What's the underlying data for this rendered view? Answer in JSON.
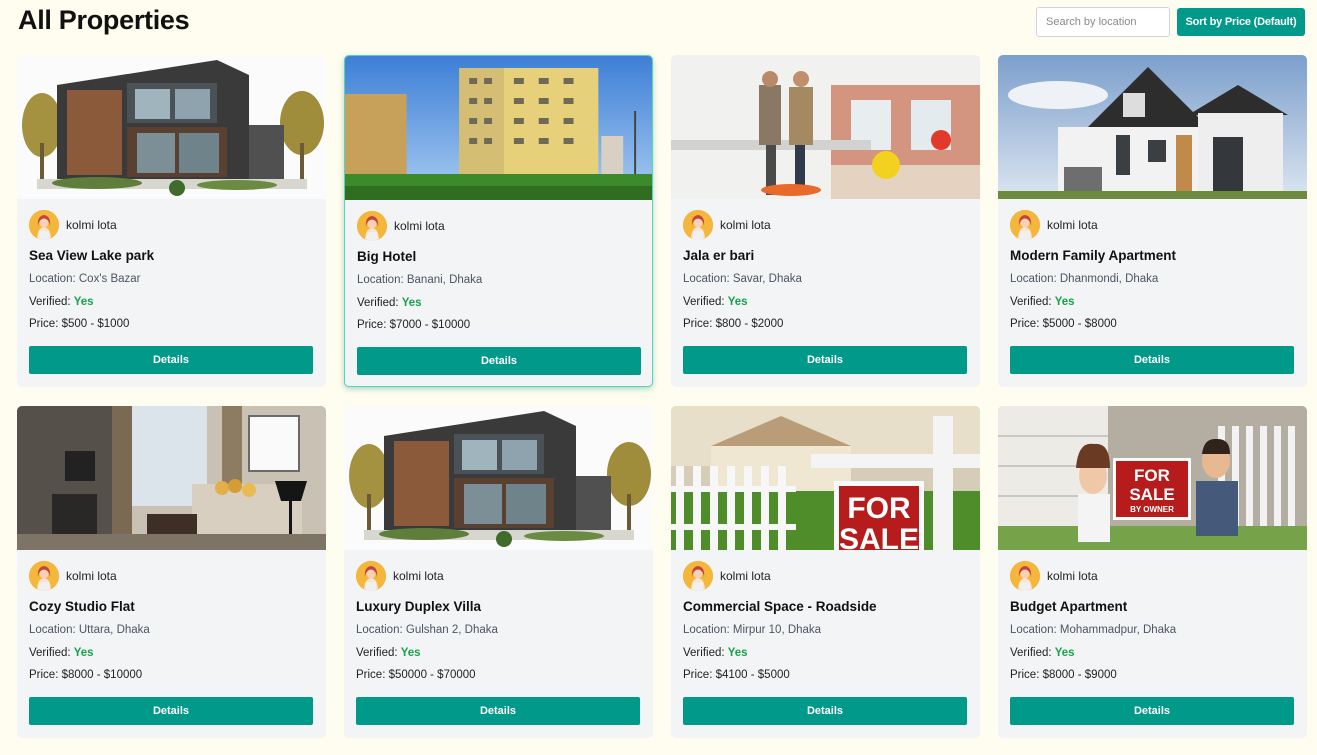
{
  "header": {
    "title": "All Properties",
    "search_placeholder": "Search by location",
    "sort_label": "Sort by Price (Default)"
  },
  "labels": {
    "verified": "Verified: "
  },
  "accent_color": "#00998a",
  "verified_color": "#16a34a",
  "properties": [
    {
      "image": "modern-villa-photo",
      "agent": "kolmi lota",
      "title": "Sea View Lake park",
      "location": "Location: Cox's Bazar",
      "verified": "Yes",
      "price": "Price: $500 - $1000",
      "details_label": "Details"
    },
    {
      "image": "apartment-tower-photo",
      "agent": "kolmi lota",
      "title": "Big Hotel",
      "location": "Location: Banani, Dhaka",
      "verified": "Yes",
      "price": "Price: $7000 - $10000",
      "details_label": "Details"
    },
    {
      "image": "office-interior-photo",
      "agent": "kolmi lota",
      "title": "Jala er bari",
      "location": "Location: Savar, Dhaka",
      "verified": "Yes",
      "price": "Price: $800 - $2000",
      "details_label": "Details"
    },
    {
      "image": "family-house-photo",
      "agent": "kolmi lota",
      "title": "Modern Family Apartment",
      "location": "Location: Dhanmondi, Dhaka",
      "verified": "Yes",
      "price": "Price: $5000 - $8000",
      "details_label": "Details"
    },
    {
      "image": "studio-flat-photo",
      "agent": "kolmi lota",
      "title": "Cozy Studio Flat",
      "location": "Location: Uttara, Dhaka",
      "verified": "Yes",
      "price": "Price: $8000 - $10000",
      "details_label": "Details"
    },
    {
      "image": "modern-villa-photo",
      "agent": "kolmi lota",
      "title": "Luxury Duplex Villa",
      "location": "Location: Gulshan 2, Dhaka",
      "verified": "Yes",
      "price": "Price: $50000 - $70000",
      "details_label": "Details"
    },
    {
      "image": "for-sale-sign-photo",
      "agent": "kolmi lota",
      "title": "Commercial Space - Roadside",
      "location": "Location: Mirpur 10, Dhaka",
      "verified": "Yes",
      "price": "Price: $4100 - $5000",
      "details_label": "Details"
    },
    {
      "image": "for-sale-by-owner-photo",
      "agent": "kolmi lota",
      "title": "Budget Apartment",
      "location": "Location: Mohammadpur, Dhaka",
      "verified": "Yes",
      "price": "Price: $8000 - $9000",
      "details_label": "Details"
    }
  ],
  "image_text": {
    "for_sale_line1": "FOR",
    "for_sale_line2": "SALE",
    "by_owner": "BY OWNER"
  }
}
